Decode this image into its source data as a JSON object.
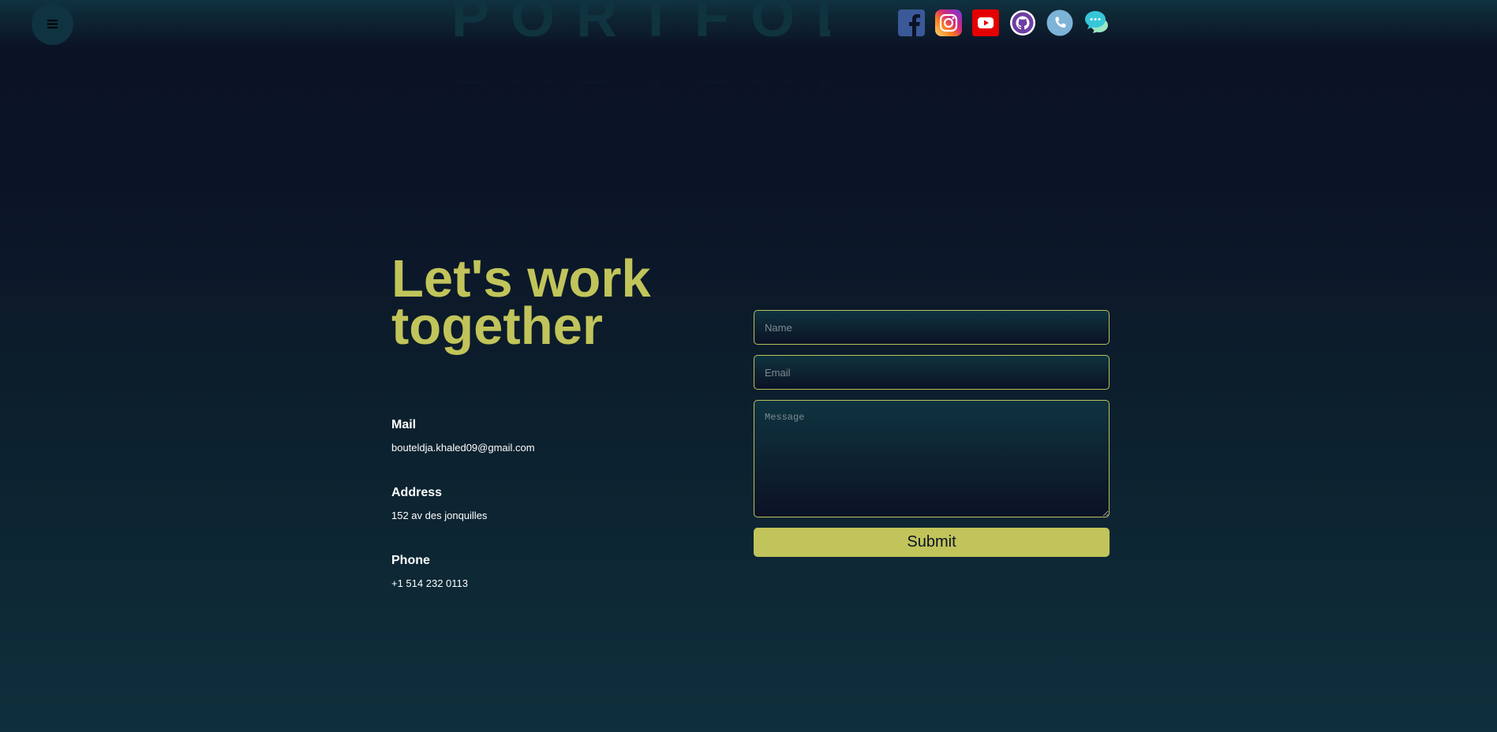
{
  "header": {
    "logo_text": "PORTFOLIO",
    "menu_icon": "hamburger-menu-icon",
    "socials": [
      {
        "name": "facebook",
        "icon": "facebook-icon",
        "color": "#3b5998"
      },
      {
        "name": "instagram",
        "icon": "instagram-icon",
        "color": "#d62976"
      },
      {
        "name": "youtube",
        "icon": "youtube-icon",
        "color": "#e40000"
      },
      {
        "name": "github",
        "icon": "github-icon",
        "color": "#6e3fa1"
      },
      {
        "name": "phone",
        "icon": "phone-icon",
        "color": "#7eb3d8"
      },
      {
        "name": "chat",
        "icon": "chat-icon",
        "color": "#37c6d9"
      }
    ]
  },
  "contact": {
    "heading": "Let's work together",
    "mail": {
      "label": "Mail",
      "value": "bouteldja.khaled09@gmail.com"
    },
    "address": {
      "label": "Address",
      "value": "152 av des jonquilles"
    },
    "phone": {
      "label": "Phone",
      "value": "+1 514 232 0113"
    }
  },
  "form": {
    "name_placeholder": "Name",
    "name_value": "",
    "email_placeholder": "Email",
    "email_value": "",
    "message_placeholder": "Message",
    "message_value": "",
    "submit_label": "Submit"
  },
  "colors": {
    "accent": "#c1c45a",
    "background_dark": "#0b1226",
    "background_teal": "#0f2f3c"
  }
}
